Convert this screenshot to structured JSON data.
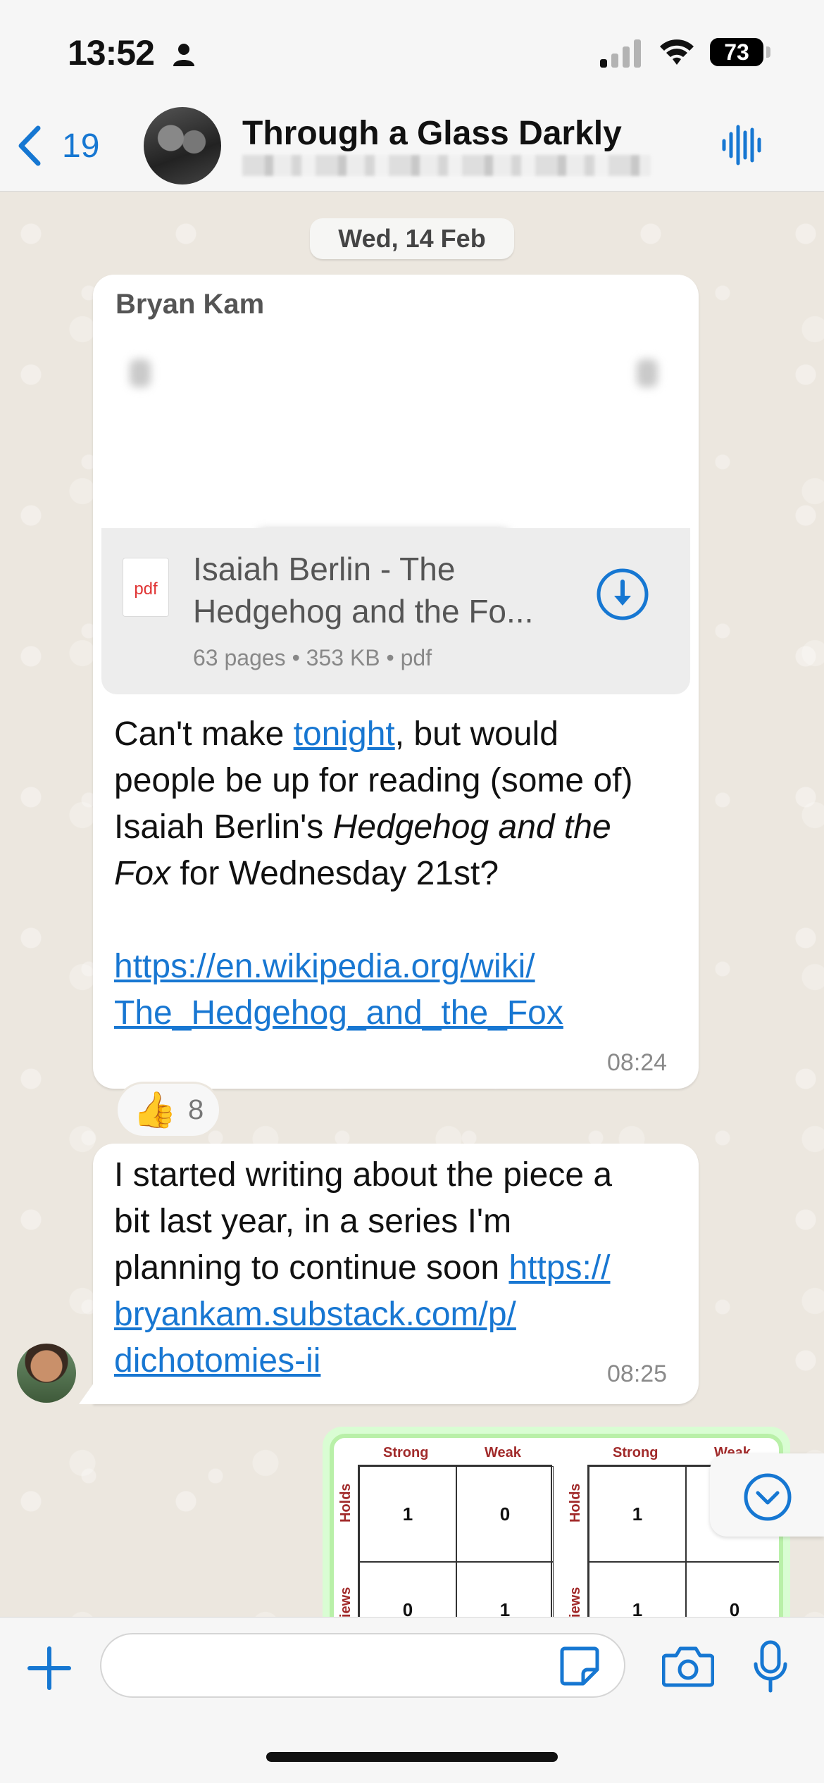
{
  "status_bar": {
    "time": "13:52",
    "battery": "73"
  },
  "header": {
    "back_count": "19",
    "title": "Through a Glass Darkly"
  },
  "date_chip": "Wed, 14 Feb",
  "messages": [
    {
      "sender": "Bryan Kam",
      "document": {
        "name_line1": "Isaiah Berlin - The",
        "name_line2": "Hedgehog and the Fo...",
        "meta": "63 pages • 353 KB • pdf",
        "icon_label": "pdf"
      },
      "text_line1_pre": "Can't make ",
      "text_line1_link": "tonight",
      "text_line1_post": ", but would",
      "text_line2": "people be up for reading (some of)",
      "text_line3_pre": "Isaiah Berlin's ",
      "text_line3_em": "Hedgehog and the",
      "text_line4_em": "Fox",
      "text_line4_post": " for Wednesday 21st?",
      "link_line1": "https://en.wikipedia.org/wiki/",
      "link_line2": "The_Hedgehog_and_the_Fox",
      "time": "08:24",
      "reaction": {
        "emoji": "👍",
        "count": "8"
      }
    },
    {
      "line1": "I started writing about the piece a",
      "line2": "bit last year, in a series I'm",
      "line3_pre": "planning to continue soon ",
      "line3_link": "https://",
      "line4_link": "bryankam.substack.com/p/",
      "line5_link": "dichotomies-ii",
      "time": "08:25"
    }
  ],
  "image_matrix": {
    "left": {
      "cols": [
        "Strong",
        "Weak"
      ],
      "rows": [
        "Holds",
        "Views"
      ],
      "cells": [
        "1",
        "0",
        "0",
        "1"
      ]
    },
    "right": {
      "cols": [
        "Strong",
        "Weak"
      ],
      "rows": [
        "Holds",
        "Views"
      ],
      "cells": [
        "1",
        "",
        "1",
        "0"
      ]
    }
  },
  "input": {
    "placeholder": ""
  },
  "colors": {
    "accent": "#1677d2",
    "link": "#1877d2",
    "outgoing": "#d9fdd3",
    "wallpaper": "#ece7df"
  }
}
